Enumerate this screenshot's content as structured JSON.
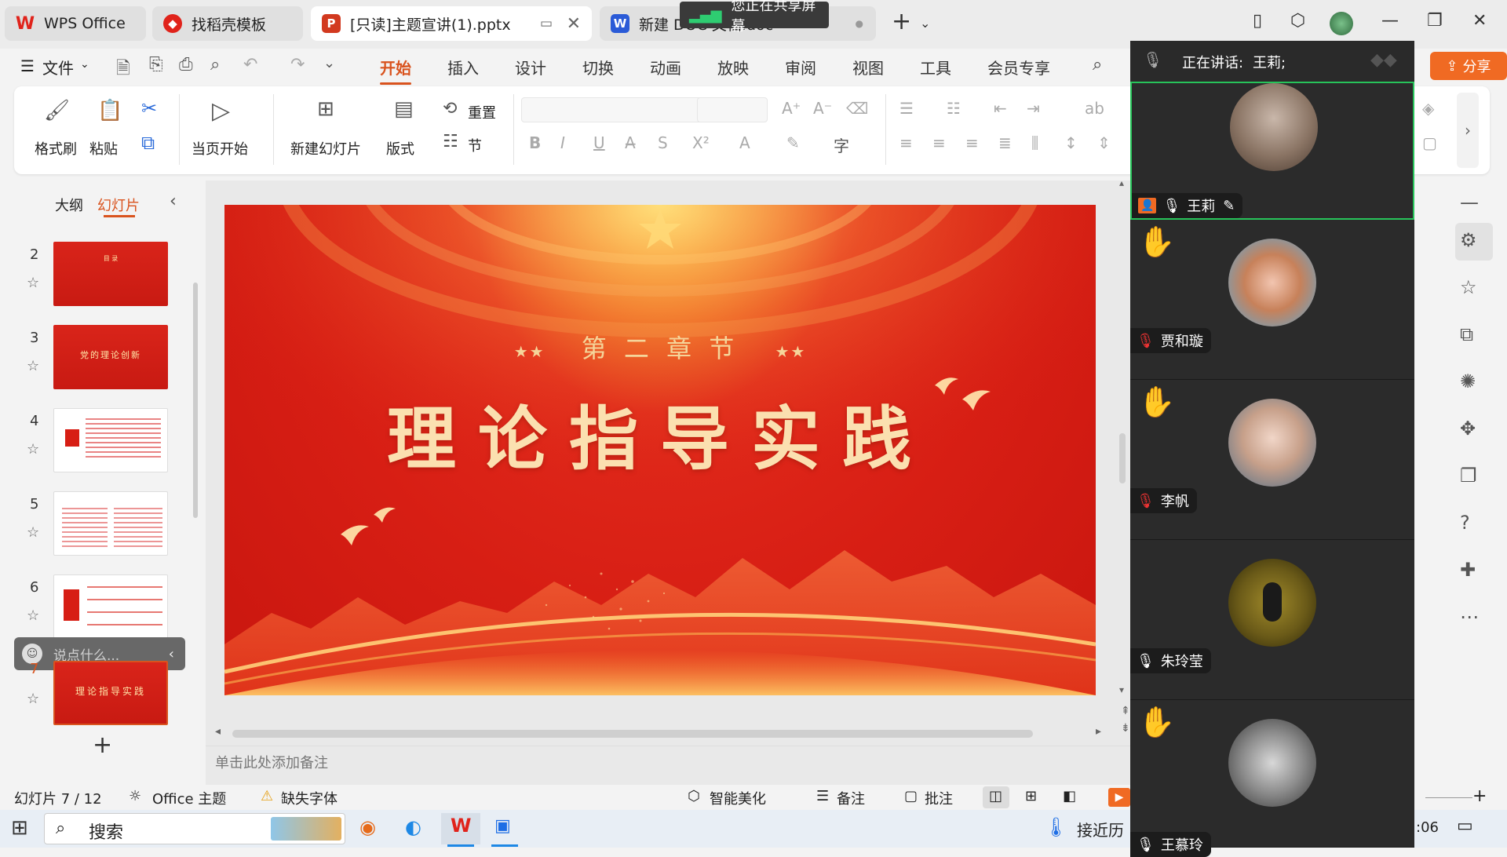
{
  "titlebar": {
    "tabs": [
      {
        "label": "WPS Office",
        "icon": "wps-logo-icon"
      },
      {
        "label": "找稻壳模板",
        "icon": "docer-icon"
      },
      {
        "label": "[只读]主题宣讲(1).pptx",
        "icon": "ppt-icon"
      },
      {
        "label": "新建 DOC 文档.doc",
        "icon": "word-icon"
      }
    ],
    "share_banner": "您正在共享屏幕"
  },
  "menu": {
    "file": "文件",
    "tabs": [
      "开始",
      "插入",
      "设计",
      "切换",
      "动画",
      "放映",
      "审阅",
      "视图",
      "工具",
      "会员专享"
    ],
    "share": "分享"
  },
  "ribbon": {
    "format_painter": "格式刷",
    "paste": "粘贴",
    "from_current": "当页开始",
    "new_slide": "新建幻灯片",
    "layout": "版式",
    "reset": "重置",
    "section": "节"
  },
  "leftpanel": {
    "tab_outline": "大纲",
    "tab_slides": "幻灯片",
    "slides": [
      {
        "num": "2",
        "text": "目 录"
      },
      {
        "num": "3",
        "text": "党的理论创新"
      },
      {
        "num": "4",
        "text": ""
      },
      {
        "num": "5",
        "text": ""
      },
      {
        "num": "6",
        "text": ""
      },
      {
        "num": "7",
        "text": "理论指导实践"
      }
    ],
    "chat_placeholder": "说点什么..."
  },
  "slide": {
    "subtitle": "第 二 章 节",
    "title": "理论指导实践"
  },
  "notes_placeholder": "单击此处添加备注",
  "statusbar": {
    "slide_count": "幻灯片 7 / 12",
    "theme": "Office 主题",
    "missing_font": "缺失字体",
    "smart_beautify": "智能美化",
    "notes": "备注",
    "comments": "批注"
  },
  "taskbar": {
    "search": "搜索",
    "weather": "接近历",
    "time": ":06"
  },
  "meeting": {
    "speaking_label": "正在讲话:",
    "speaking_name": "王莉;",
    "participants": [
      {
        "name": "王莉",
        "mic": "on",
        "hand": false,
        "host": true
      },
      {
        "name": "贾和璇",
        "mic": "off",
        "hand": true
      },
      {
        "name": "李帆",
        "mic": "off",
        "hand": true
      },
      {
        "name": "朱玲莹",
        "mic": "on",
        "hand": false
      },
      {
        "name": "王慕玲",
        "mic": "on",
        "hand": true
      }
    ]
  },
  "colors": {
    "accent": "#d9531e",
    "slide_red": "#d71e14",
    "gold": "#f7d9a0",
    "meeting_bg": "#262626",
    "active_border": "#27c35a"
  }
}
